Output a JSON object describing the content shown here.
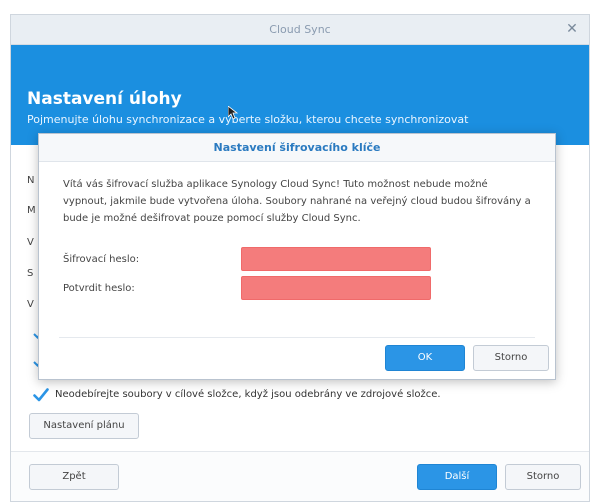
{
  "window": {
    "title": "Cloud Sync",
    "close_glyph": "✕"
  },
  "header": {
    "title": "Nastavení úlohy",
    "subtitle": "Pojmenujte úlohu synchronizace a vyberte složku, kterou chcete synchronizovat"
  },
  "form": {
    "partial_labels": [
      "N",
      "M",
      "V",
      "S",
      "V"
    ],
    "checkbox_label": "Neodebírejte soubory v cílové složce, když jsou odebrány ve zdrojové složce.",
    "checkbox_checked": true,
    "schedule_button": "Nastavení plánu"
  },
  "footer": {
    "back_button": "Zpět",
    "next_button": "Další",
    "cancel_button": "Storno"
  },
  "dialog": {
    "title": "Nastavení šifrovacího klíče",
    "description": "Vítá vás šifrovací služba aplikace Synology Cloud Sync! Tuto možnost nebude možné vypnout, jakmile bude vytvořena úloha. Soubory nahrané na veřejný cloud budou šifrovány a bude je možné dešifrovat pouze pomocí služby Cloud Sync.",
    "password_label": "Šifrovací heslo:",
    "password_value": "",
    "confirm_label": "Potvrdit heslo:",
    "confirm_value": "",
    "ok_button": "OK",
    "cancel_button": "Storno"
  },
  "colors": {
    "header_blue": "#1b8fe0",
    "primary_button": "#2b95e6",
    "error_field": "#f47c7c",
    "dialog_title": "#2a7ac0"
  },
  "icons": {
    "check": "checkmark-icon",
    "close": "close-icon",
    "cursor": "mouse-cursor-icon"
  }
}
